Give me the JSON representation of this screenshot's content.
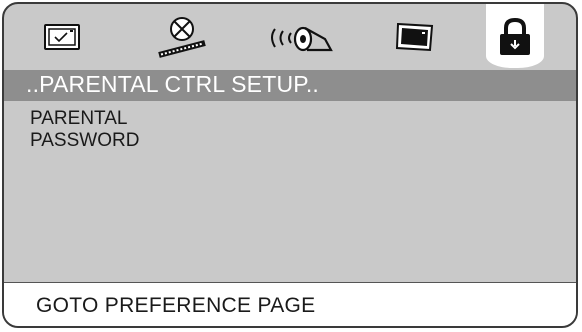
{
  "icons": [
    {
      "name": "tv-display-icon"
    },
    {
      "name": "disc-reel-icon"
    },
    {
      "name": "speaker-audio-icon"
    },
    {
      "name": "video-screen-icon"
    },
    {
      "name": "lock-icon"
    }
  ],
  "colors": {
    "panel": "#c9c9c9",
    "title_bar": "#8e8e8e",
    "selected_tab": "#ffffff",
    "footer": "#ffffff"
  },
  "page_title": "..PARENTAL CTRL SETUP..",
  "menu": {
    "items": [
      {
        "label": "PARENTAL"
      },
      {
        "label": "PASSWORD"
      }
    ]
  },
  "footer": {
    "label": "GOTO PREFERENCE PAGE"
  }
}
